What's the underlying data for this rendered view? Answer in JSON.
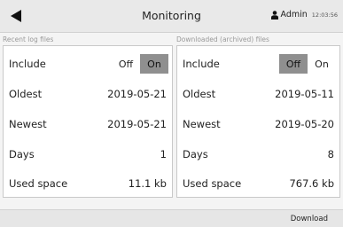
{
  "header": {
    "title": "Monitoring",
    "back_icon": "back-arrow-icon",
    "user_icon": "user-icon",
    "user": "Admin",
    "time": "12:03:56"
  },
  "recent": {
    "section_label": "Recent log files",
    "include_label": "Include",
    "off_label": "Off",
    "on_label": "On",
    "include_state": "On",
    "oldest_label": "Oldest",
    "oldest_value": "2019-05-21",
    "newest_label": "Newest",
    "newest_value": "2019-05-21",
    "days_label": "Days",
    "days_value": "1",
    "used_label": "Used space",
    "used_value": "11.1 kb"
  },
  "archived": {
    "section_label": "Downloaded (archived) files",
    "include_label": "Include",
    "off_label": "Off",
    "on_label": "On",
    "include_state": "Off",
    "oldest_label": "Oldest",
    "oldest_value": "2019-05-11",
    "newest_label": "Newest",
    "newest_value": "2019-05-20",
    "days_label": "Days",
    "days_value": "8",
    "used_label": "Used space",
    "used_value": "767.6 kb"
  },
  "footer": {
    "download_label": "Download"
  },
  "colors": {
    "toggle_active": "#8f8f8f",
    "header_bg": "#e9e9e9"
  }
}
